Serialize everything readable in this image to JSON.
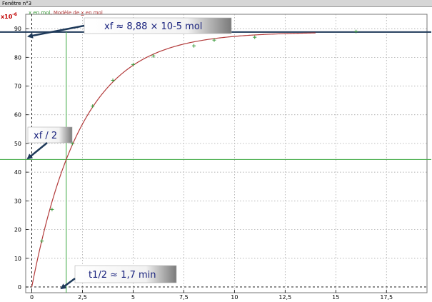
{
  "window": {
    "title": "Fenêtre n°3"
  },
  "legend": {
    "series1": "x en mol",
    "separator": ", ",
    "series2_prefix": "Modèle de ",
    "series2_var": "x",
    "series2_suffix": " en mol"
  },
  "yscale_label": {
    "base": "x10",
    "exp": "-6"
  },
  "annotations": {
    "xf": "xf ≈ 8,88 × 10-5 mol",
    "half": "xf / 2",
    "thalf": "t1/2  ≈ 1,7 min"
  },
  "colors": {
    "data": "#3a9a3a",
    "model": "#b23a3a",
    "asymptote": "#1f3a5a",
    "halfline": "#4caf50",
    "callout_text": "#1a237e",
    "yscale": "#c00000"
  },
  "chart_data": {
    "type": "scatter",
    "xlim": [
      -0.3,
      19.5
    ],
    "ylim": [
      -2,
      95
    ],
    "xticks": [
      0,
      2.5,
      5,
      7.5,
      10,
      12.5,
      15,
      17.5
    ],
    "xtick_labels": [
      "0",
      "2,5",
      "5",
      "7,5",
      "10",
      "12,5",
      "15",
      "17,5"
    ],
    "yticks": [
      0,
      10,
      20,
      30,
      40,
      50,
      60,
      70,
      80,
      90
    ],
    "ytick_labels": [
      "0",
      "10",
      "20",
      "30",
      "40",
      "50",
      "60",
      "70",
      "80",
      "90"
    ],
    "grid": true,
    "series": [
      {
        "name": "x en mol",
        "kind": "points",
        "x": [
          0.5,
          1,
          2,
          3,
          4,
          5,
          6,
          8,
          9,
          11,
          16
        ],
        "y": [
          16,
          27,
          50,
          63,
          72,
          77.5,
          80.5,
          84,
          86,
          87,
          89
        ]
      },
      {
        "name": "Modèle de x en mol",
        "kind": "model",
        "xmax": 14,
        "asymptote": 88.8,
        "half_time": 1.7
      }
    ],
    "reference_lines": {
      "xf": 88.8,
      "half_value": 44.4,
      "t_half": 1.7
    }
  }
}
